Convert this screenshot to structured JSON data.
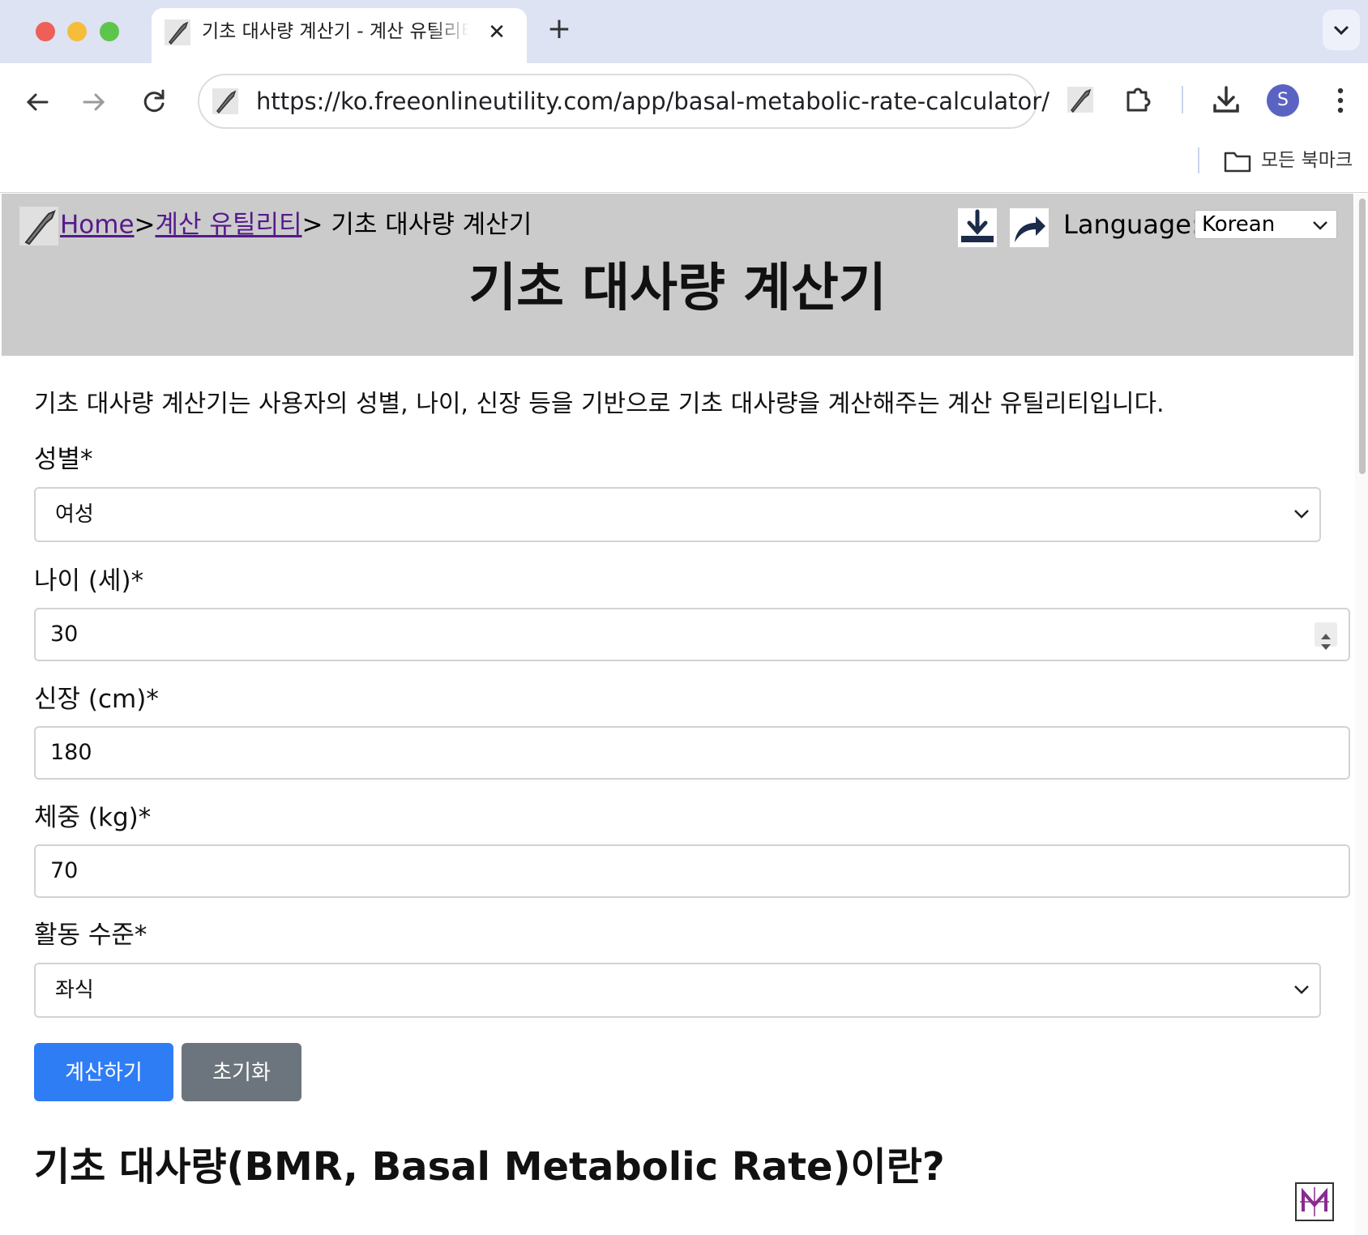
{
  "browser": {
    "tab_title": "기초 대사량 계산기 - 계산 유틸리티",
    "url": "https://ko.freeonlineutility.com/app/basal-metabolic-rate-calculator/",
    "bookmarks_label": "모든 북마크",
    "profile_initial": "S"
  },
  "page": {
    "breadcrumb": {
      "home": "Home",
      "sep1": ">",
      "category": "계산 유틸리티",
      "sep2": ">",
      "current": " 기초 대사량 계산기"
    },
    "language_label": "Language:",
    "language_value": "Korean",
    "title": "기초 대사량 계산기",
    "intro": "기초 대사량 계산기는 사용자의 성별, 나이, 신장 등을 기반으로 기초 대사량을 계산해주는 계산 유틸리티입니다.",
    "form": {
      "gender_label": "성별*",
      "gender_value": "여성",
      "age_label": "나이 (세)*",
      "age_value": "30",
      "height_label": "신장 (cm)*",
      "height_value": "180",
      "weight_label": "체중 (kg)*",
      "weight_value": "70",
      "activity_label": "활동 수준*",
      "activity_value": "좌식"
    },
    "buttons": {
      "calculate": "계산하기",
      "reset": "초기화"
    },
    "section_heading": "기초 대사량(BMR, Basal Metabolic Rate)이란?"
  },
  "colors": {
    "header_band": "#cbcbcb",
    "primary_button": "#2f7df5",
    "secondary_button": "#6c757d",
    "link": "#551a8b"
  },
  "icons": [
    "wrench-icon",
    "close-icon",
    "plus-icon",
    "chevron-down-icon",
    "back-arrow-icon",
    "forward-arrow-icon",
    "reload-icon",
    "extensions-icon",
    "download-icon",
    "kebab-menu-icon",
    "folder-icon",
    "share-icon"
  ]
}
